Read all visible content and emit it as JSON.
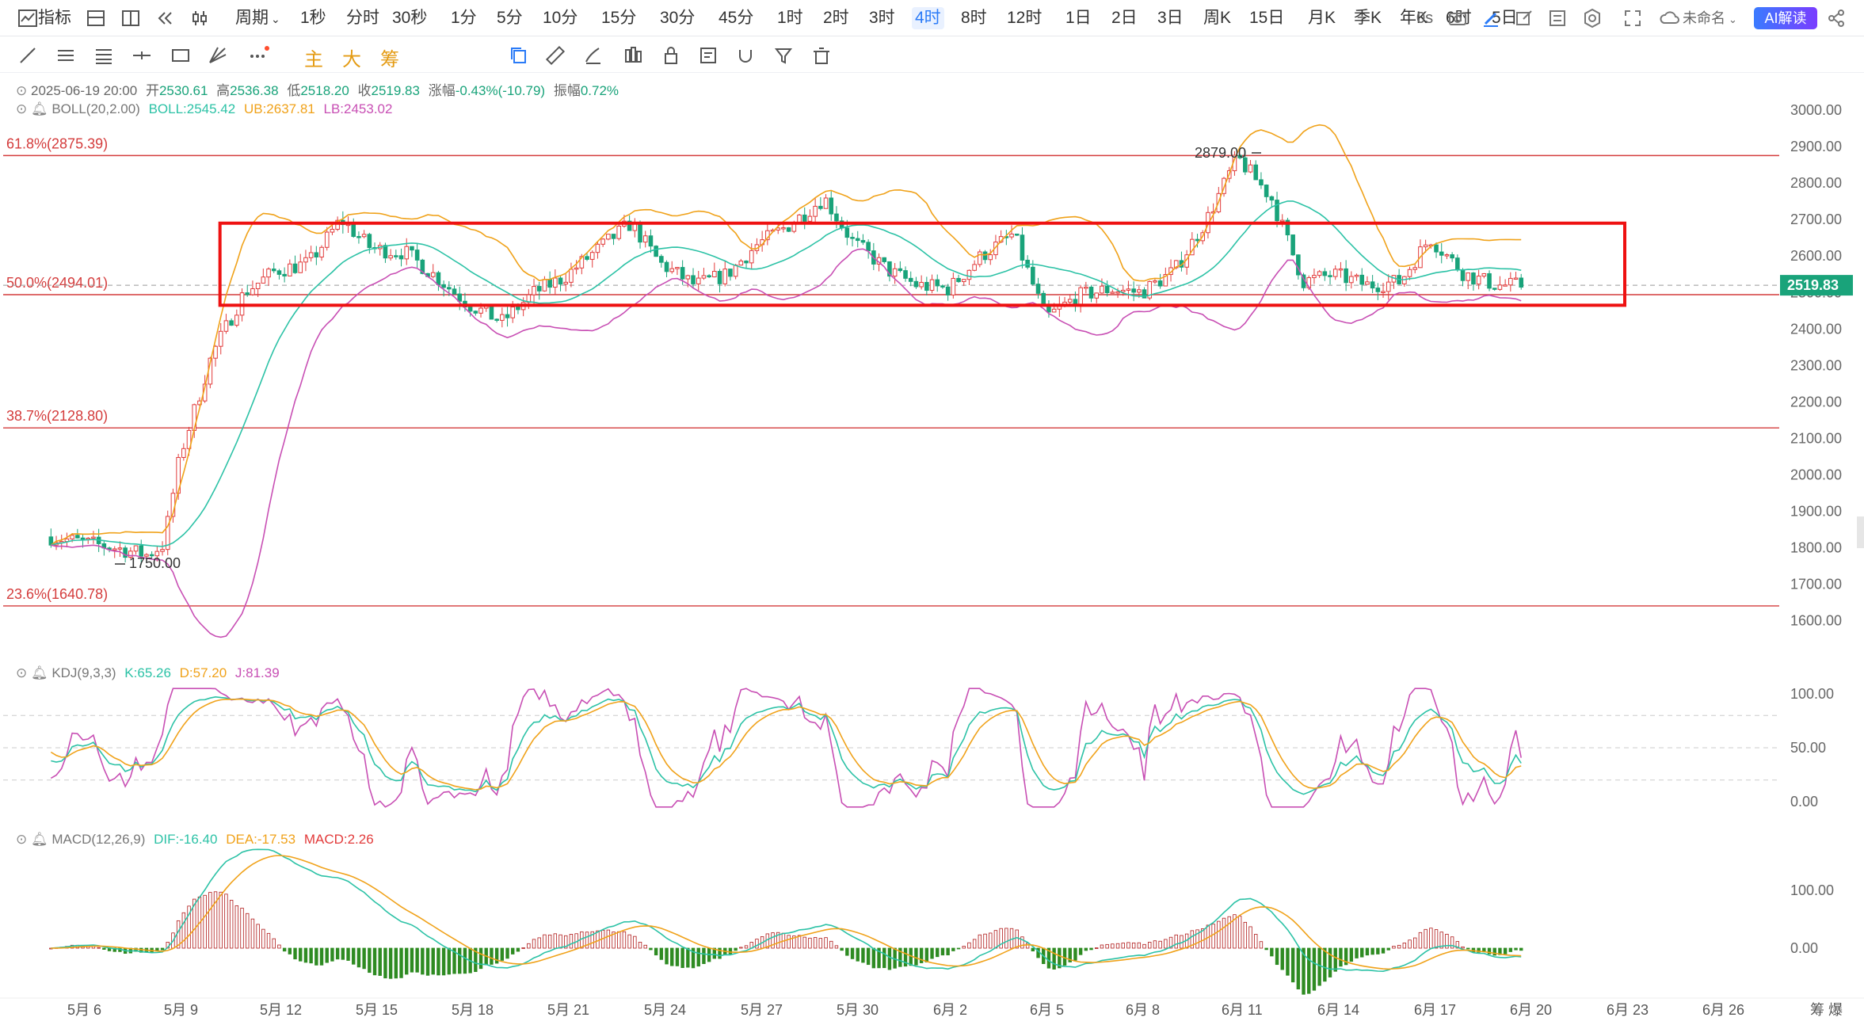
{
  "toolbar": {
    "indicator_label": "指标",
    "period_label": "周期",
    "periods": [
      "1秒",
      "分时",
      "30秒",
      "1分",
      "5分",
      "10分",
      "15分",
      "30分",
      "45分",
      "1时",
      "2时",
      "3时",
      "4时",
      "8时",
      "12时",
      "1日",
      "2日",
      "3日",
      "周K",
      "15日",
      "月K",
      "季K",
      "年K",
      "6时",
      "5日"
    ],
    "active_period": "4时",
    "latency": "0s",
    "workspace_name": "未命名",
    "ai_button": "AI解读"
  },
  "drawing_toolbar": {
    "chips": [
      "主",
      "大",
      "筹"
    ]
  },
  "ohlc_info": {
    "datetime": "2025-06-19 20:00",
    "open_label": "开",
    "open": "2530.61",
    "high_label": "高",
    "high": "2536.38",
    "low_label": "低",
    "low": "2518.20",
    "close_label": "收",
    "close": "2519.83",
    "change_label": "涨幅",
    "change": "-0.43%(-10.79)",
    "amplitude_label": "振幅",
    "amplitude": "0.72%"
  },
  "boll": {
    "name": "BOLL(20,2.00)",
    "boll": "BOLL:2545.42",
    "ub": "UB:2637.81",
    "lb": "LB:2453.02"
  },
  "kdj": {
    "name": "KDJ(9,3,3)",
    "k": "K:65.26",
    "d": "D:57.20",
    "j": "J:81.39"
  },
  "macd": {
    "name": "MACD(12,26,9)",
    "dif": "DIF:-16.40",
    "dea": "DEA:-17.53",
    "macd": "MACD:2.26"
  },
  "fib_levels": [
    {
      "label": "61.8%(2875.39)",
      "value": 2875.39
    },
    {
      "label": "50.0%(2494.01)",
      "value": 2494.01
    },
    {
      "label": "38.7%(2128.80)",
      "value": 2128.8
    },
    {
      "label": "23.6%(1640.78)",
      "value": 1640.78
    }
  ],
  "annotations": {
    "high_marker": "2879.00",
    "low_marker": "1750.00"
  },
  "last_price_tag": "2519.83",
  "price_axis": [
    "3000.00",
    "2900.00",
    "2800.00",
    "2700.00",
    "2600.00",
    "2500.00",
    "2400.00",
    "2300.00",
    "2200.00",
    "2100.00",
    "2000.00",
    "1900.00",
    "1800.00",
    "1700.00",
    "1600.00"
  ],
  "kdj_axis": [
    "100.00",
    "50.00",
    "0.00"
  ],
  "macd_axis": [
    "100.00",
    "0.00"
  ],
  "date_axis": [
    "5月 6",
    "5月 9",
    "5月 12",
    "5月 15",
    "5月 18",
    "5月 21",
    "5月 24",
    "5月 27",
    "5月 30",
    "6月 2",
    "6月 5",
    "6月 8",
    "6月 11",
    "6月 14",
    "6月 17",
    "6月 20",
    "6月 23",
    "6月 26"
  ],
  "corner_label": "筹 爆",
  "colors": {
    "up": "#e23b3b",
    "down": "#19a37a",
    "boll_mid": "#2cc2a6",
    "boll_ub": "#f0a21a",
    "boll_lb": "#c84fb4",
    "fib": "#d43c3c",
    "range_box": "#ee1111",
    "accent": "#2b7bf7"
  },
  "chart_data": {
    "type": "candlestick",
    "title": "",
    "timeframe": "4时",
    "y_range": [
      1600,
      3000
    ],
    "range_box": {
      "from": "5月 10",
      "to": "6月 20",
      "low": 2465,
      "high": 2690
    },
    "price_path": [
      {
        "date": "5月 5",
        "close": 1830
      },
      {
        "date": "5月 6",
        "close": 1815
      },
      {
        "date": "5月 7",
        "close": 1800
      },
      {
        "date": "5月 8",
        "close": 1780
      },
      {
        "date": "5月 8 pm",
        "close": 1810
      },
      {
        "date": "5月 9",
        "close": 2050
      },
      {
        "date": "5月 10",
        "close": 2330
      },
      {
        "date": "5月 11",
        "close": 2500
      },
      {
        "date": "5月 12",
        "close": 2560
      },
      {
        "date": "5月 13",
        "close": 2580
      },
      {
        "date": "5月 14",
        "close": 2700
      },
      {
        "date": "5月 15",
        "close": 2620
      },
      {
        "date": "5月 16",
        "close": 2610
      },
      {
        "date": "5月 17",
        "close": 2540
      },
      {
        "date": "5月 18",
        "close": 2470
      },
      {
        "date": "5月 19",
        "close": 2420
      },
      {
        "date": "5月 20",
        "close": 2500
      },
      {
        "date": "5月 21",
        "close": 2540
      },
      {
        "date": "5月 22",
        "close": 2620
      },
      {
        "date": "5月 23",
        "close": 2690
      },
      {
        "date": "5月 24",
        "close": 2580
      },
      {
        "date": "5月 25",
        "close": 2520
      },
      {
        "date": "5月 26",
        "close": 2550
      },
      {
        "date": "5月 27",
        "close": 2630
      },
      {
        "date": "5月 28",
        "close": 2690
      },
      {
        "date": "5月 29",
        "close": 2760
      },
      {
        "date": "5月 30",
        "close": 2640
      },
      {
        "date": "5月 31",
        "close": 2560
      },
      {
        "date": "6月 1",
        "close": 2520
      },
      {
        "date": "6月 2",
        "close": 2510
      },
      {
        "date": "6月 3",
        "close": 2600
      },
      {
        "date": "6月 4",
        "close": 2660
      },
      {
        "date": "6月 5",
        "close": 2430
      },
      {
        "date": "6月 6",
        "close": 2490
      },
      {
        "date": "6月 7",
        "close": 2510
      },
      {
        "date": "6月 8",
        "close": 2500
      },
      {
        "date": "6月 9",
        "close": 2560
      },
      {
        "date": "6月 10",
        "close": 2700
      },
      {
        "date": "6月 11",
        "close": 2870
      },
      {
        "date": "6月 12",
        "close": 2760
      },
      {
        "date": "6月 13",
        "close": 2530
      },
      {
        "date": "6月 14",
        "close": 2550
      },
      {
        "date": "6月 15",
        "close": 2520
      },
      {
        "date": "6月 16",
        "close": 2530
      },
      {
        "date": "6月 17",
        "close": 2650
      },
      {
        "date": "6月 18",
        "close": 2550
      },
      {
        "date": "6月 19",
        "close": 2520
      },
      {
        "date": "6月 20",
        "close": 2519.83
      }
    ],
    "kdj_range": [
      0,
      100
    ],
    "macd_range": [
      -60,
      160
    ]
  }
}
